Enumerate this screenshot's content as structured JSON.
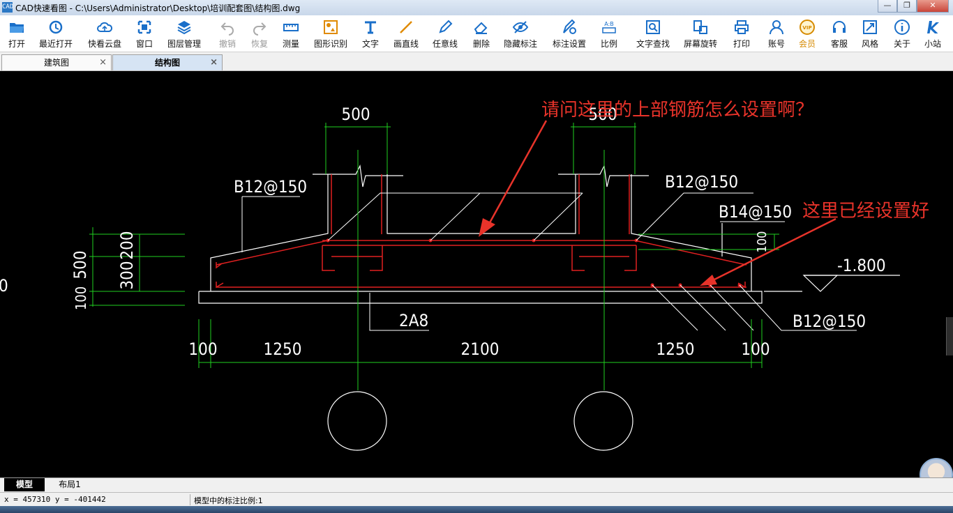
{
  "window": {
    "app_icon": "CAD",
    "title": "CAD快速看图 - C:\\Users\\Administrator\\Desktop\\培训配套图\\结构图.dwg",
    "buttons": [
      "—",
      "❐",
      "✕"
    ]
  },
  "toolbar": [
    {
      "label": "打开",
      "icon": "folder-open-icon",
      "enabled": true
    },
    {
      "label": "最近打开",
      "icon": "history-icon",
      "enabled": true
    },
    {
      "label": "快看云盘",
      "icon": "cloud-icon",
      "enabled": true
    },
    {
      "label": "窗口",
      "icon": "window-icon",
      "enabled": true
    },
    {
      "label": "图层管理",
      "icon": "layers-icon",
      "enabled": true
    },
    {
      "label": "撤销",
      "icon": "undo-icon",
      "enabled": false
    },
    {
      "label": "恢复",
      "icon": "redo-icon",
      "enabled": false
    },
    {
      "label": "测量",
      "icon": "ruler-icon",
      "enabled": true
    },
    {
      "label": "图形识别",
      "icon": "shape-recognize-icon",
      "enabled": true
    },
    {
      "label": "文字",
      "icon": "text-icon",
      "enabled": true
    },
    {
      "label": "画直线",
      "icon": "line-icon",
      "enabled": true
    },
    {
      "label": "任意线",
      "icon": "pen-icon",
      "enabled": true
    },
    {
      "label": "删除",
      "icon": "eraser-icon",
      "enabled": true
    },
    {
      "label": "隐藏标注",
      "icon": "eye-hide-icon",
      "enabled": true
    },
    {
      "label": "标注设置",
      "icon": "annotation-settings-icon",
      "enabled": true
    },
    {
      "label": "比例",
      "icon": "scale-icon",
      "enabled": true
    },
    {
      "label": "文字查找",
      "icon": "text-search-icon",
      "enabled": true
    },
    {
      "label": "屏幕旋转",
      "icon": "rotate-screen-icon",
      "enabled": true
    },
    {
      "label": "打印",
      "icon": "printer-icon",
      "enabled": true
    },
    {
      "label": "账号",
      "icon": "user-icon",
      "enabled": true
    },
    {
      "label": "会员",
      "icon": "vip-icon",
      "enabled": true
    },
    {
      "label": "客服",
      "icon": "headset-icon",
      "enabled": true
    },
    {
      "label": "风格",
      "icon": "style-icon",
      "enabled": true
    },
    {
      "label": "关于",
      "icon": "info-icon",
      "enabled": true
    },
    {
      "label": "小站",
      "icon": "k-logo-icon",
      "enabled": true
    }
  ],
  "tabs": [
    {
      "label": "建筑图",
      "active": false,
      "close": "×"
    },
    {
      "label": "结构图",
      "active": true,
      "close": "×"
    }
  ],
  "drawing": {
    "dims": {
      "col_width_left": "500",
      "col_width_right": "500",
      "height_total": "500",
      "height_300": "300",
      "height_200": "200",
      "height_100": "100",
      "small_100": "100",
      "span_100_left": "100",
      "span_1250_left": "1250",
      "span_2100": "2100",
      "span_1250_right": "1250",
      "span_100_right": "100"
    },
    "labels": {
      "b12_left": "B12@150",
      "b12_right": "B12@150",
      "b14": "B14@150",
      "b12_bottom": "B12@150",
      "a8": "2A8",
      "elev": "-1.800",
      "edge_zero": "0"
    },
    "annotations": {
      "question": "请问这里的上部钢筋怎么设置啊？",
      "answer": "这里已经设置好"
    }
  },
  "layout_tabs": [
    {
      "label": "模型",
      "active": true
    },
    {
      "label": "布局1",
      "active": false
    }
  ],
  "status": {
    "coords": "x = 457310   y = -401442",
    "scale_text": "模型中的标注比例:1"
  }
}
